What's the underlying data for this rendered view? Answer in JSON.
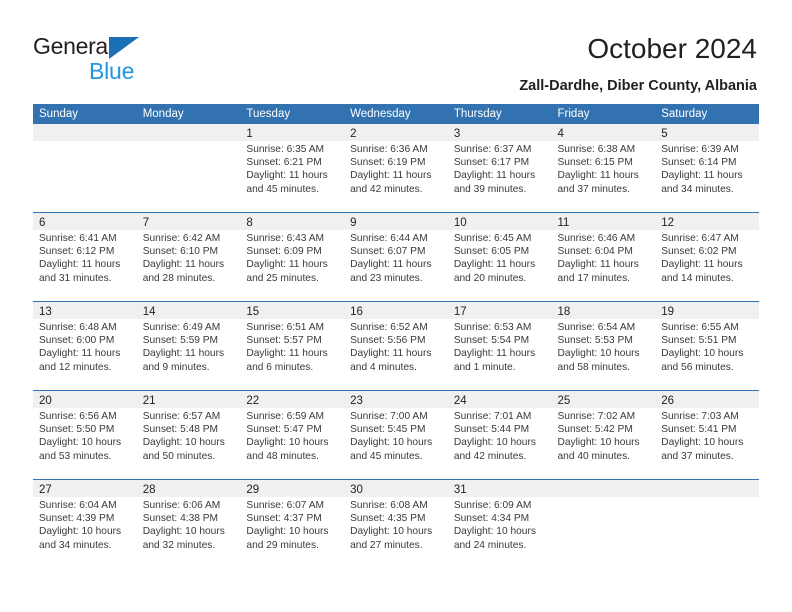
{
  "brand": {
    "name_part1": "General",
    "name_part2": "Blue",
    "accent_color": "#1a6fb5",
    "accent_color_light": "#2196e3"
  },
  "header": {
    "title": "October 2024",
    "subtitle": "Zall-Dardhe, Diber County, Albania"
  },
  "theme": {
    "header_blue": "#3272b0",
    "daynum_band": "#f0f0f0",
    "text": "#231f20"
  },
  "weekday_headers": [
    "Sunday",
    "Monday",
    "Tuesday",
    "Wednesday",
    "Thursday",
    "Friday",
    "Saturday"
  ],
  "labels": {
    "sunrise_prefix": "Sunrise:",
    "sunset_prefix": "Sunset:",
    "daylight_prefix": "Daylight:"
  },
  "weeks": [
    [
      {
        "day": "",
        "empty": true
      },
      {
        "day": "",
        "empty": true
      },
      {
        "day": "1",
        "sunrise": "Sunrise: 6:35 AM",
        "sunset": "Sunset: 6:21 PM",
        "daylight_line1": "Daylight: 11 hours",
        "daylight_line2": "and 45 minutes."
      },
      {
        "day": "2",
        "sunrise": "Sunrise: 6:36 AM",
        "sunset": "Sunset: 6:19 PM",
        "daylight_line1": "Daylight: 11 hours",
        "daylight_line2": "and 42 minutes."
      },
      {
        "day": "3",
        "sunrise": "Sunrise: 6:37 AM",
        "sunset": "Sunset: 6:17 PM",
        "daylight_line1": "Daylight: 11 hours",
        "daylight_line2": "and 39 minutes."
      },
      {
        "day": "4",
        "sunrise": "Sunrise: 6:38 AM",
        "sunset": "Sunset: 6:15 PM",
        "daylight_line1": "Daylight: 11 hours",
        "daylight_line2": "and 37 minutes."
      },
      {
        "day": "5",
        "sunrise": "Sunrise: 6:39 AM",
        "sunset": "Sunset: 6:14 PM",
        "daylight_line1": "Daylight: 11 hours",
        "daylight_line2": "and 34 minutes."
      }
    ],
    [
      {
        "day": "6",
        "sunrise": "Sunrise: 6:41 AM",
        "sunset": "Sunset: 6:12 PM",
        "daylight_line1": "Daylight: 11 hours",
        "daylight_line2": "and 31 minutes."
      },
      {
        "day": "7",
        "sunrise": "Sunrise: 6:42 AM",
        "sunset": "Sunset: 6:10 PM",
        "daylight_line1": "Daylight: 11 hours",
        "daylight_line2": "and 28 minutes."
      },
      {
        "day": "8",
        "sunrise": "Sunrise: 6:43 AM",
        "sunset": "Sunset: 6:09 PM",
        "daylight_line1": "Daylight: 11 hours",
        "daylight_line2": "and 25 minutes."
      },
      {
        "day": "9",
        "sunrise": "Sunrise: 6:44 AM",
        "sunset": "Sunset: 6:07 PM",
        "daylight_line1": "Daylight: 11 hours",
        "daylight_line2": "and 23 minutes."
      },
      {
        "day": "10",
        "sunrise": "Sunrise: 6:45 AM",
        "sunset": "Sunset: 6:05 PM",
        "daylight_line1": "Daylight: 11 hours",
        "daylight_line2": "and 20 minutes."
      },
      {
        "day": "11",
        "sunrise": "Sunrise: 6:46 AM",
        "sunset": "Sunset: 6:04 PM",
        "daylight_line1": "Daylight: 11 hours",
        "daylight_line2": "and 17 minutes."
      },
      {
        "day": "12",
        "sunrise": "Sunrise: 6:47 AM",
        "sunset": "Sunset: 6:02 PM",
        "daylight_line1": "Daylight: 11 hours",
        "daylight_line2": "and 14 minutes."
      }
    ],
    [
      {
        "day": "13",
        "sunrise": "Sunrise: 6:48 AM",
        "sunset": "Sunset: 6:00 PM",
        "daylight_line1": "Daylight: 11 hours",
        "daylight_line2": "and 12 minutes."
      },
      {
        "day": "14",
        "sunrise": "Sunrise: 6:49 AM",
        "sunset": "Sunset: 5:59 PM",
        "daylight_line1": "Daylight: 11 hours",
        "daylight_line2": "and 9 minutes."
      },
      {
        "day": "15",
        "sunrise": "Sunrise: 6:51 AM",
        "sunset": "Sunset: 5:57 PM",
        "daylight_line1": "Daylight: 11 hours",
        "daylight_line2": "and 6 minutes."
      },
      {
        "day": "16",
        "sunrise": "Sunrise: 6:52 AM",
        "sunset": "Sunset: 5:56 PM",
        "daylight_line1": "Daylight: 11 hours",
        "daylight_line2": "and 4 minutes."
      },
      {
        "day": "17",
        "sunrise": "Sunrise: 6:53 AM",
        "sunset": "Sunset: 5:54 PM",
        "daylight_line1": "Daylight: 11 hours",
        "daylight_line2": "and 1 minute."
      },
      {
        "day": "18",
        "sunrise": "Sunrise: 6:54 AM",
        "sunset": "Sunset: 5:53 PM",
        "daylight_line1": "Daylight: 10 hours",
        "daylight_line2": "and 58 minutes."
      },
      {
        "day": "19",
        "sunrise": "Sunrise: 6:55 AM",
        "sunset": "Sunset: 5:51 PM",
        "daylight_line1": "Daylight: 10 hours",
        "daylight_line2": "and 56 minutes."
      }
    ],
    [
      {
        "day": "20",
        "sunrise": "Sunrise: 6:56 AM",
        "sunset": "Sunset: 5:50 PM",
        "daylight_line1": "Daylight: 10 hours",
        "daylight_line2": "and 53 minutes."
      },
      {
        "day": "21",
        "sunrise": "Sunrise: 6:57 AM",
        "sunset": "Sunset: 5:48 PM",
        "daylight_line1": "Daylight: 10 hours",
        "daylight_line2": "and 50 minutes."
      },
      {
        "day": "22",
        "sunrise": "Sunrise: 6:59 AM",
        "sunset": "Sunset: 5:47 PM",
        "daylight_line1": "Daylight: 10 hours",
        "daylight_line2": "and 48 minutes."
      },
      {
        "day": "23",
        "sunrise": "Sunrise: 7:00 AM",
        "sunset": "Sunset: 5:45 PM",
        "daylight_line1": "Daylight: 10 hours",
        "daylight_line2": "and 45 minutes."
      },
      {
        "day": "24",
        "sunrise": "Sunrise: 7:01 AM",
        "sunset": "Sunset: 5:44 PM",
        "daylight_line1": "Daylight: 10 hours",
        "daylight_line2": "and 42 minutes."
      },
      {
        "day": "25",
        "sunrise": "Sunrise: 7:02 AM",
        "sunset": "Sunset: 5:42 PM",
        "daylight_line1": "Daylight: 10 hours",
        "daylight_line2": "and 40 minutes."
      },
      {
        "day": "26",
        "sunrise": "Sunrise: 7:03 AM",
        "sunset": "Sunset: 5:41 PM",
        "daylight_line1": "Daylight: 10 hours",
        "daylight_line2": "and 37 minutes."
      }
    ],
    [
      {
        "day": "27",
        "sunrise": "Sunrise: 6:04 AM",
        "sunset": "Sunset: 4:39 PM",
        "daylight_line1": "Daylight: 10 hours",
        "daylight_line2": "and 34 minutes."
      },
      {
        "day": "28",
        "sunrise": "Sunrise: 6:06 AM",
        "sunset": "Sunset: 4:38 PM",
        "daylight_line1": "Daylight: 10 hours",
        "daylight_line2": "and 32 minutes."
      },
      {
        "day": "29",
        "sunrise": "Sunrise: 6:07 AM",
        "sunset": "Sunset: 4:37 PM",
        "daylight_line1": "Daylight: 10 hours",
        "daylight_line2": "and 29 minutes."
      },
      {
        "day": "30",
        "sunrise": "Sunrise: 6:08 AM",
        "sunset": "Sunset: 4:35 PM",
        "daylight_line1": "Daylight: 10 hours",
        "daylight_line2": "and 27 minutes."
      },
      {
        "day": "31",
        "sunrise": "Sunrise: 6:09 AM",
        "sunset": "Sunset: 4:34 PM",
        "daylight_line1": "Daylight: 10 hours",
        "daylight_line2": "and 24 minutes."
      },
      {
        "day": "",
        "empty": true
      },
      {
        "day": "",
        "empty": true
      }
    ]
  ]
}
